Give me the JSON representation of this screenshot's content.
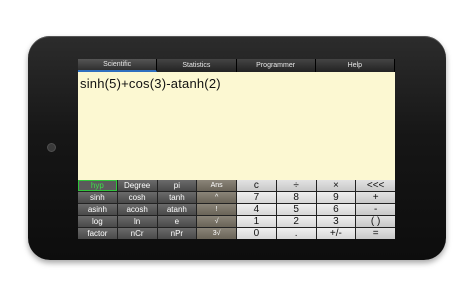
{
  "tabs": [
    {
      "label": "Scientific",
      "active": true
    },
    {
      "label": "Statistics",
      "active": false
    },
    {
      "label": "Programmer",
      "active": false
    },
    {
      "label": "Help",
      "active": false
    }
  ],
  "display": {
    "expression": "sinh(5)+cos(3)-atanh(2)"
  },
  "keys": [
    [
      "hyp",
      "Degree",
      "pi",
      "Ans",
      "c",
      "÷",
      "×",
      "<<<"
    ],
    [
      "sinh",
      "cosh",
      "tanh",
      "^",
      "7",
      "8",
      "9",
      "+"
    ],
    [
      "asinh",
      "acosh",
      "atanh",
      "!",
      "4",
      "5",
      "6",
      "-"
    ],
    [
      "log",
      "ln",
      "e",
      "√",
      "1",
      "2",
      "3",
      "( )"
    ],
    [
      "factor",
      "nCr",
      "nPr",
      "3√",
      "0",
      ".",
      "+/-",
      "="
    ]
  ],
  "colors": {
    "display_bg": "#fcf8d2",
    "hyp_active": "#3fe04a",
    "tab_indicator": "#2f6fbf"
  }
}
